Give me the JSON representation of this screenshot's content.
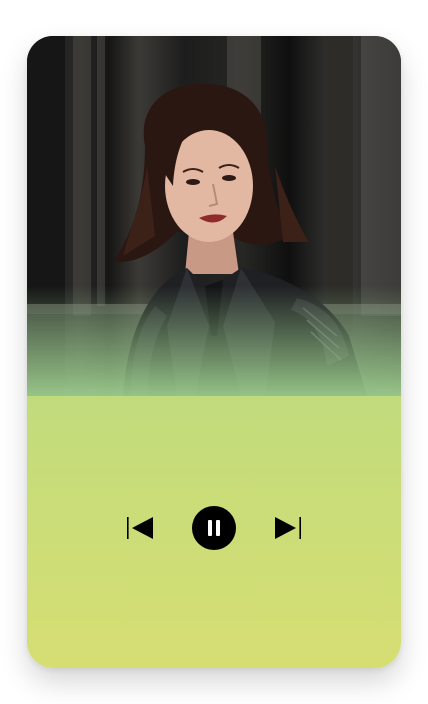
{
  "player": {
    "state": "playing",
    "controls": {
      "previous_icon": "skip-previous-icon",
      "pause_icon": "pause-icon",
      "next_icon": "skip-next-icon"
    },
    "colors": {
      "gradient_top": "#9fd08f",
      "gradient_bottom": "#d6de73",
      "controls": "#000000"
    }
  }
}
